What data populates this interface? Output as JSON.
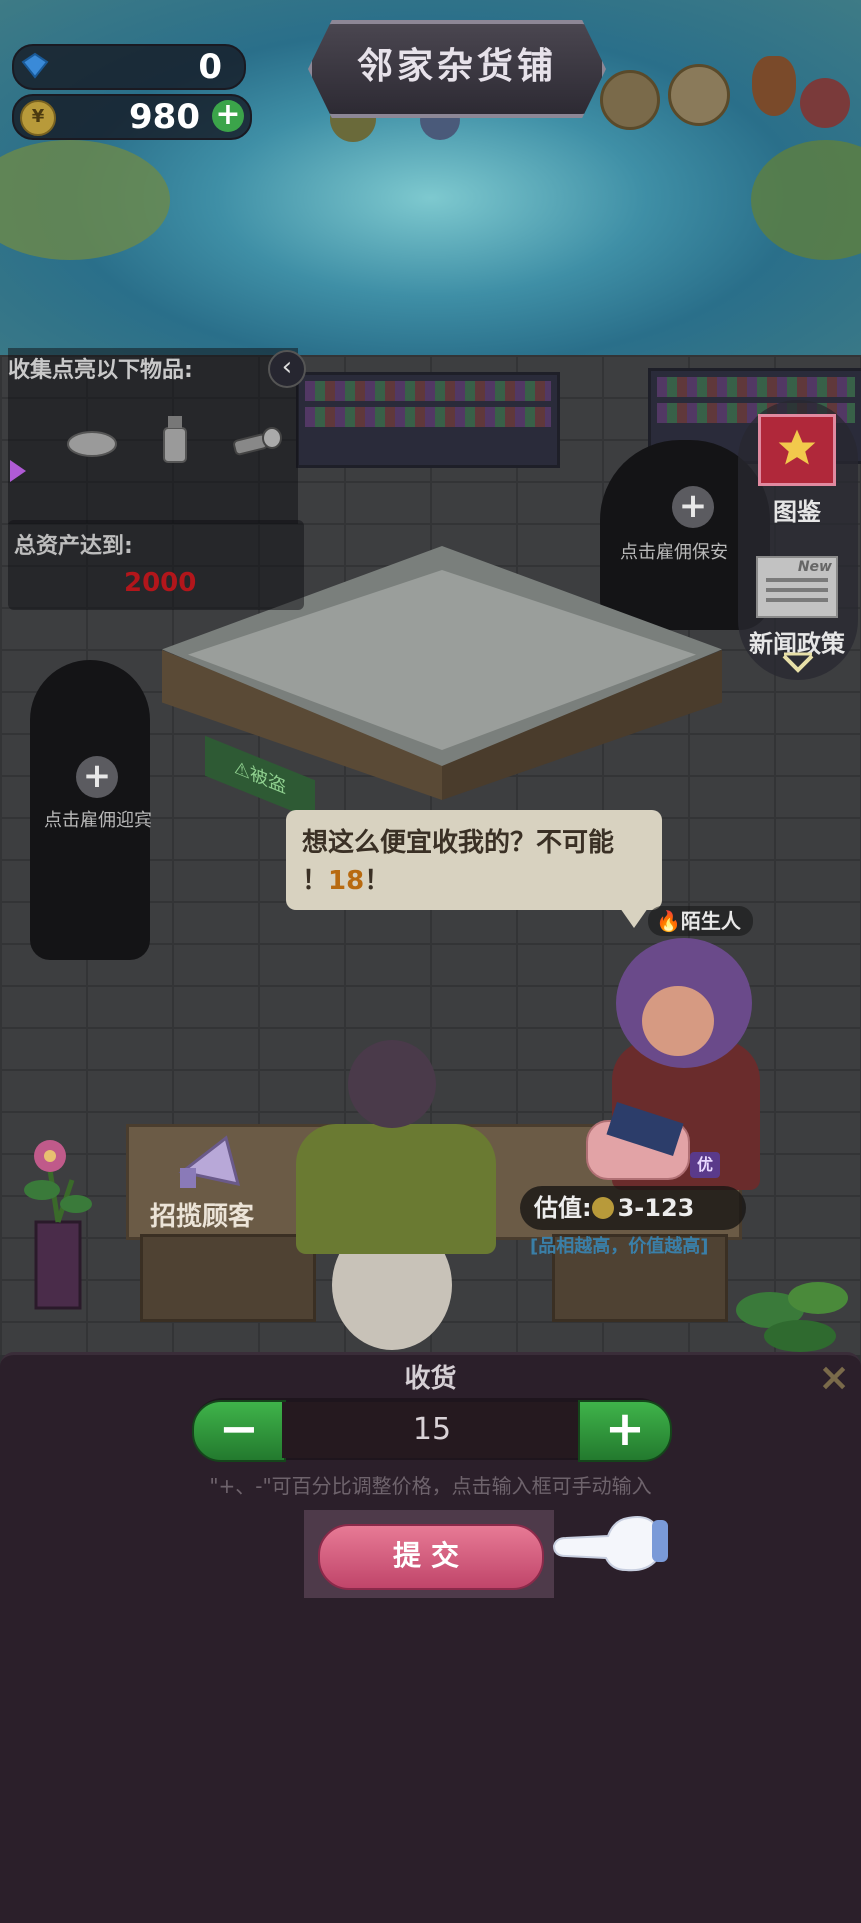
{
  "resources": {
    "gems": "0",
    "coins": "980",
    "coin_symbol": "¥"
  },
  "shop_title": "邻家杂货铺",
  "quest": {
    "collect_label": "收集点亮以下物品:",
    "items": [
      "soap-icon",
      "bottle-icon",
      "flashlight-icon"
    ],
    "asset_label": "总资产达到:",
    "asset_target": "2000"
  },
  "side_menu": {
    "catalog_label": "图鉴",
    "news_label": "新闻政策",
    "news_tag": "New"
  },
  "hire": {
    "security_label": "点击雇佣保安",
    "greeter_label": "点击雇佣迎宾"
  },
  "display_case_sign": "⚠被盗",
  "dialogue": {
    "line1": "想这么便宜收我的？不可能",
    "line2_prefix": "！",
    "amount": "18",
    "line2_suffix": "！"
  },
  "customer": {
    "tag": "陌生人",
    "quality_badge": "优"
  },
  "counter": {
    "solicit_label": "招揽顾客",
    "estimate_label": "估值:",
    "estimate_range": "3-123",
    "estimate_note": "[品相越高，价值越高]"
  },
  "purchase_panel": {
    "title": "收货",
    "minus_label": "−",
    "plus_label": "+",
    "quantity": "15",
    "hint": "\"+、-\"可百分比调整价格，点击输入框可手动输入",
    "submit_label": "提交",
    "close_label": "×"
  },
  "colors": {
    "panel_bg": "#2b1f2a",
    "submit_pink": "#e77a95",
    "stepper_green": "#3fb44a",
    "asset_target_red": "#b2161b",
    "estimate_note_blue": "#3a7fa8"
  }
}
